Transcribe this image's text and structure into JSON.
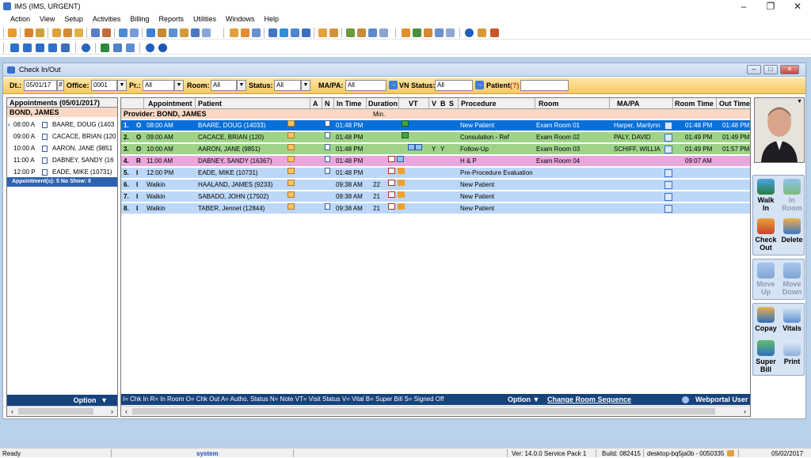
{
  "app": {
    "title": "IMS (IMS, URGENT)"
  },
  "menu": [
    "Action",
    "View",
    "Setup",
    "Activities",
    "Billing",
    "Reports",
    "Utilities",
    "Windows",
    "Help"
  ],
  "window": {
    "title": "Check In/Out"
  },
  "filter": {
    "dt_label": "Dt.:",
    "dt_value": "05/01/17",
    "office_label": "Office:",
    "office_value": "0001",
    "pr_label": "Pr.:",
    "pr_value": "All",
    "room_label": "Room:",
    "room_value": "All",
    "status_label": "Status:",
    "status_value": "All",
    "mapa_label": "MA/PA:",
    "mapa_value": "All",
    "vn_label": "VN Status:",
    "vn_value": "All",
    "patient_label": "Patient",
    "patient_hint": "(?)",
    "patient_value": ""
  },
  "left": {
    "header": "Appointments (05/01/2017)",
    "provider": "BOND, JAMES",
    "rows": [
      {
        "time": "08:00 A",
        "name": "BAARE, DOUG  (1403"
      },
      {
        "time": "09:00 A",
        "name": "CACACE, BRIAN  (120"
      },
      {
        "time": "10:00 A",
        "name": "AARON, JANE  (9851"
      },
      {
        "time": "11:00 A",
        "name": "DABNEY, SANDY  (16"
      },
      {
        "time": "12:00 P",
        "name": "EADE, MIKE  (10731)"
      }
    ],
    "summary": "Appointment(s): 5    No Show: 0",
    "option": "Option"
  },
  "grid": {
    "headers": {
      "appointment": "Appointment",
      "patient": "Patient",
      "a": "A",
      "n": "N",
      "intime": "In Time",
      "duration": "Duration",
      "vt": "VT",
      "v": "V",
      "b": "B",
      "s": "S",
      "procedure": "Procedure",
      "room": "Room",
      "mapa": "MA/PA",
      "roomtime": "Room Time",
      "outtime": "Out Time"
    },
    "provider": "Provider: BOND, JAMES",
    "min_label": "Min.",
    "rows": [
      {
        "num": "1.",
        "st": "O",
        "appt": "08:00 AM",
        "patient": "BAARE, DOUG  (14033)",
        "intime": "01:48 PM",
        "dur": "",
        "v": "",
        "b": "",
        "procedure": "New Patient",
        "room": "Exam Room 01",
        "mapa": "Harper, Marilynn",
        "roomtime": "01:48 PM",
        "outtime": "01:48 PM"
      },
      {
        "num": "2.",
        "st": "O",
        "appt": "09:00 AM",
        "patient": "CACACE, BRIAN  (120)",
        "intime": "01:48 PM",
        "dur": "",
        "v": "",
        "b": "",
        "procedure": "Consulation - Ref",
        "room": "Exam Room 02",
        "mapa": "PALY, DAVID",
        "roomtime": "01:49 PM",
        "outtime": "01:49 PM"
      },
      {
        "num": "3.",
        "st": "O",
        "appt": "10:00 AM",
        "patient": "AARON, JANE  (9851)",
        "intime": "01:48 PM",
        "dur": "",
        "v": "Y",
        "b": "Y",
        "procedure": "Follow-Up",
        "room": "Exam Room 03",
        "mapa": "SCHIFF, WILLIA",
        "roomtime": "01:49 PM",
        "outtime": "01:57 PM"
      },
      {
        "num": "4.",
        "st": "R",
        "appt": "11:00 AM",
        "patient": "DABNEY, SANDY  (16367)",
        "intime": "01:48 PM",
        "dur": "",
        "v": "",
        "b": "",
        "procedure": "H & P",
        "room": "Exam Room 04",
        "mapa": "",
        "roomtime": "09:07 AM",
        "outtime": ""
      },
      {
        "num": "5.",
        "st": "I",
        "appt": "12:00 PM",
        "patient": "EADE, MIKE  (10731)",
        "intime": "01:48 PM",
        "dur": "",
        "v": "",
        "b": "",
        "procedure": "Pre-Procedure Evaluation",
        "room": "",
        "mapa": "",
        "roomtime": "",
        "outtime": ""
      },
      {
        "num": "6.",
        "st": "I",
        "appt": "Walkin",
        "patient": "HAALAND, JAMES  (9233)",
        "intime": "09:38 AM",
        "dur": "22",
        "v": "",
        "b": "",
        "procedure": "New Patient",
        "room": "",
        "mapa": "",
        "roomtime": "",
        "outtime": ""
      },
      {
        "num": "7.",
        "st": "I",
        "appt": "Walkin",
        "patient": "SABADO, JOHN  (17502)",
        "intime": "09:38 AM",
        "dur": "21",
        "v": "",
        "b": "",
        "procedure": "New Patient",
        "room": "",
        "mapa": "",
        "roomtime": "",
        "outtime": ""
      },
      {
        "num": "8.",
        "st": "I",
        "appt": "Walkin",
        "patient": "TABER, Jennet  (12844)",
        "intime": "09:38 AM",
        "dur": "21",
        "v": "",
        "b": "",
        "procedure": "New Patient",
        "room": "",
        "mapa": "",
        "roomtime": "",
        "outtime": ""
      }
    ],
    "row_colors": [
      "#0a6fd8",
      "#9fd38a",
      "#9fd38a",
      "#e9a7dd",
      "#bcd7f7",
      "#bcd7f7",
      "#bcd7f7",
      "#bcd7f7"
    ],
    "legend": "I= Chk In  R= In Room  O= Chk Out  A= Autho. Status  N= Note  VT= Visit Status  V= Vital  B= Super Bill  S= Signed Off",
    "option": "Option",
    "change_room": "Change Room Sequence",
    "webportal": "Webportal User"
  },
  "actions": {
    "walk_in": [
      "Walk",
      "In"
    ],
    "in_room": [
      "In",
      "Room"
    ],
    "check_out": [
      "Check",
      "Out"
    ],
    "delete": [
      "Delete"
    ],
    "move_up": [
      "Move",
      "Up"
    ],
    "move_down": [
      "Move",
      "Down"
    ],
    "copay": [
      "Copay"
    ],
    "vitals": [
      "Vitals"
    ],
    "super_bill": [
      "Super",
      "Bill"
    ],
    "print": [
      "Print"
    ]
  },
  "status": {
    "ready": "Ready",
    "user": "system",
    "version": "Ver: 14.0.0 Service Pack 1",
    "build": "Build: 082415",
    "machine": "desktop-bq5ja0b - 0050335",
    "date": "05/02/2017"
  },
  "colors": {
    "accent": "#17437d",
    "selected": "#0a6fd8",
    "filter_bg": "#f7c861",
    "provider_bg": "#fad8c3",
    "mdi_bg": "#b9d1ea"
  }
}
